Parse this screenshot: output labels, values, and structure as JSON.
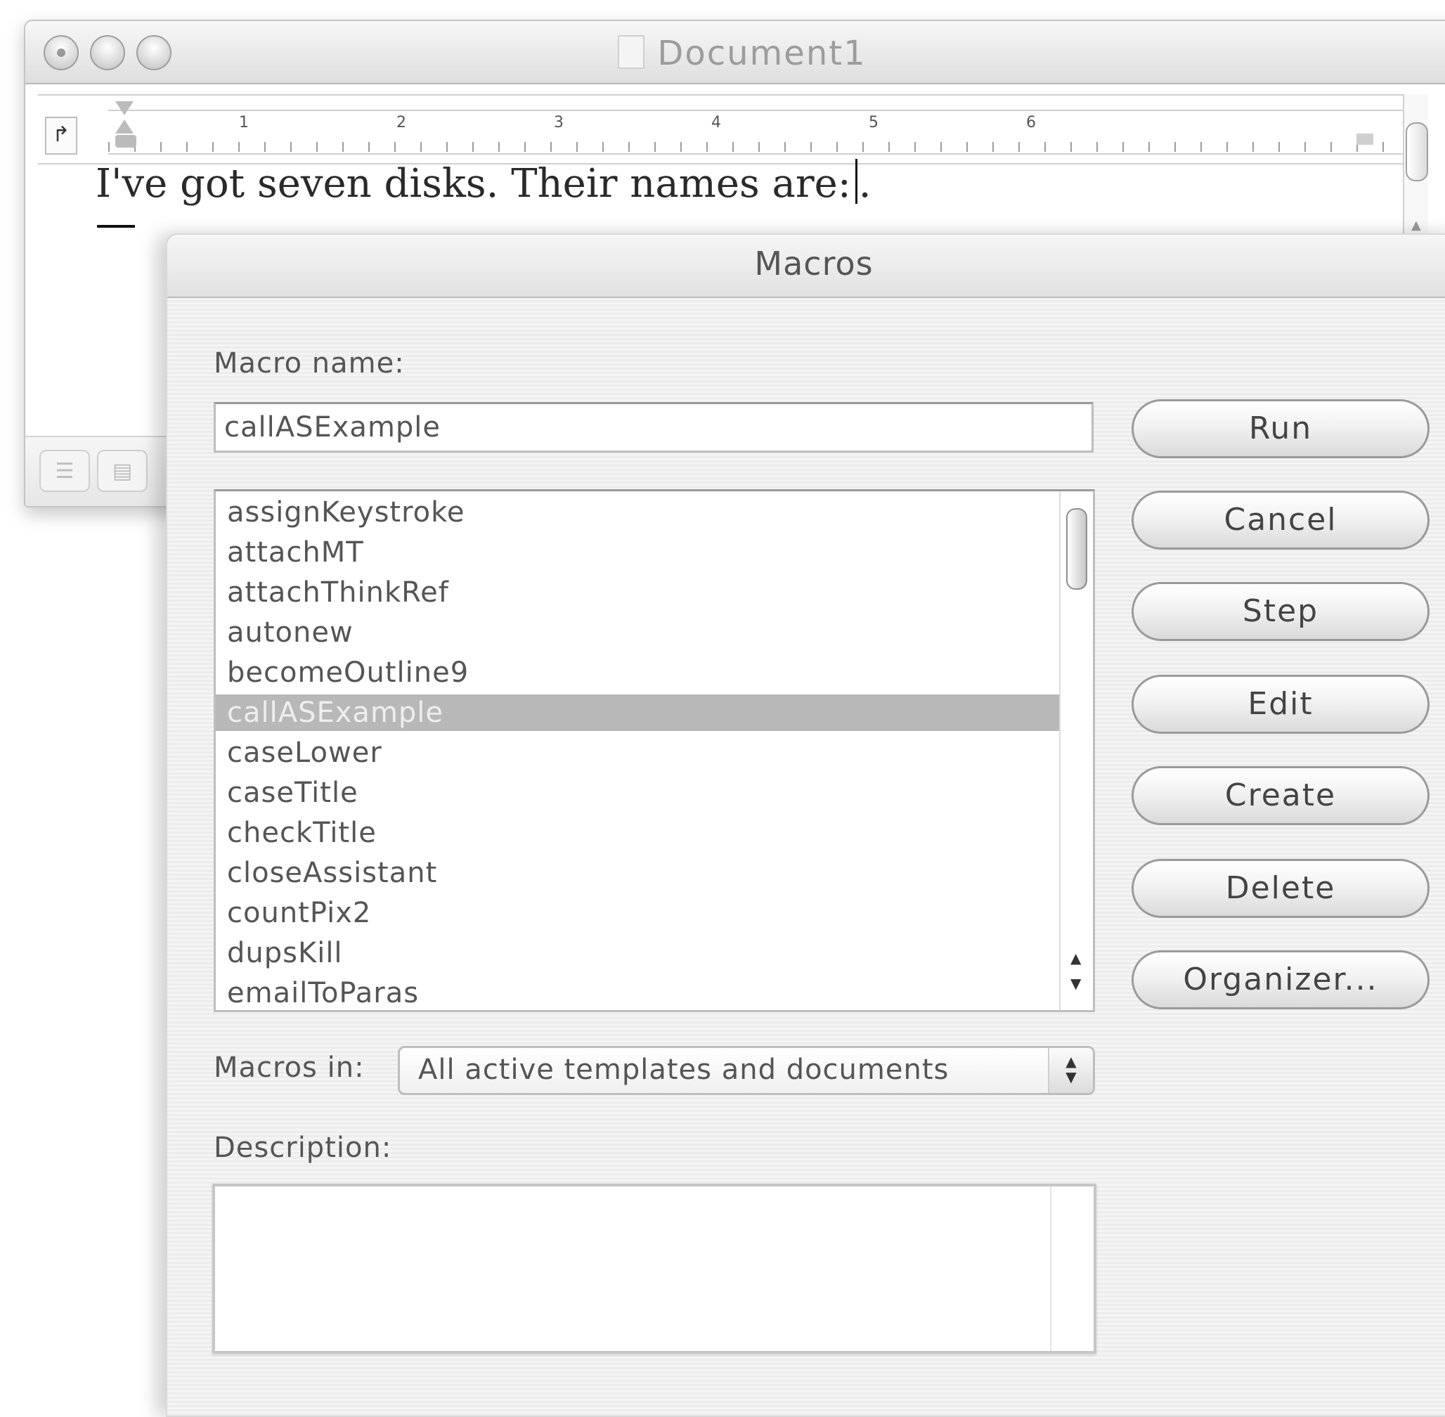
{
  "document_window": {
    "title": "Document1",
    "ruler_numbers": [
      "1",
      "2",
      "3",
      "4",
      "5",
      "6"
    ],
    "body_text": "I've got seven disks. Their names are:",
    "body_text_after_caret": "."
  },
  "macros_dialog": {
    "title": "Macros",
    "macro_name_label": "Macro name:",
    "macro_name_value": "callASExample",
    "macro_list": [
      "assignKeystroke",
      "attachMT",
      "attachThinkRef",
      "autonew",
      "becomeOutline9",
      "callASExample",
      "caseLower",
      "caseTitle",
      "checkTitle",
      "closeAssistant",
      "countPix2",
      "dupsKill",
      "emailToParas"
    ],
    "selected_macro": "callASExample",
    "macros_in_label": "Macros in:",
    "macros_in_value": "All active templates and documents",
    "description_label": "Description:",
    "description_value": "",
    "buttons": {
      "run": "Run",
      "cancel": "Cancel",
      "step": "Step",
      "edit": "Edit",
      "create": "Create",
      "delete": "Delete",
      "organizer": "Organizer..."
    }
  },
  "icons": {
    "window_controls": [
      "close-button-icon",
      "minimize-button-icon",
      "zoom-button-icon"
    ],
    "list_scroll": [
      "scroll-up-arrow-icon",
      "scroll-down-arrow-icon"
    ],
    "popup": "popup-stepper-arrows-icon"
  }
}
